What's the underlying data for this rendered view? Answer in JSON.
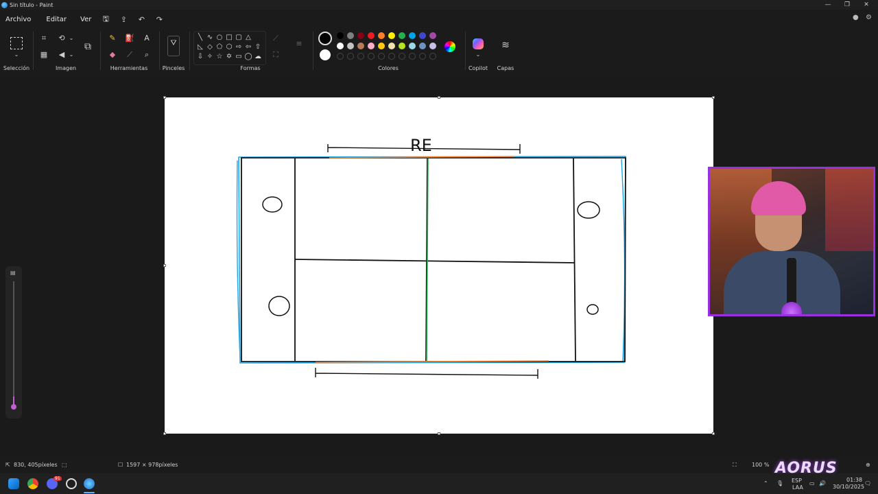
{
  "window": {
    "title": "Sin título - Paint",
    "controls": [
      "—",
      "❐",
      "✕"
    ]
  },
  "menu": {
    "items": [
      "Archivo",
      "Editar",
      "Ver"
    ]
  },
  "ribbon": {
    "groups": {
      "seleccion": "Selección",
      "imagen": "Imagen",
      "herramientas": "Herramientas",
      "pinceles": "Pinceles",
      "formas": "Formas",
      "colores": "Colores",
      "copilot": "Copilot",
      "capas": "Capas"
    },
    "colors": {
      "active_primary": "#000000",
      "active_secondary": "#ffffff",
      "row1": [
        "#000000",
        "#7f7f7f",
        "#880015",
        "#ed1c24",
        "#ff7f27",
        "#fff200",
        "#22b14c",
        "#00a2e8",
        "#3f48cc",
        "#a349a4"
      ],
      "row2": [
        "#ffffff",
        "#c3c3c3",
        "#b97a57",
        "#ffaec9",
        "#ffc90e",
        "#efe4b0",
        "#b5e61d",
        "#99d9ea",
        "#7092be",
        "#c8bfe7"
      ]
    }
  },
  "canvas": {
    "drawing": {
      "label": "RE",
      "stroke_colors": {
        "outline": "#00a2e8",
        "baseline": "#ff7f27",
        "centerline": "#22b14c",
        "lines": "#000000"
      }
    }
  },
  "status": {
    "cursor": "830, 405píxeles",
    "canvas_size": "1597 × 978píxeles",
    "zoom": "100 %"
  },
  "taskbar": {
    "lang": "ESP",
    "lang2": "LAA",
    "time": "01:38",
    "date": "30/10/2025",
    "discord_badge": "91"
  },
  "overlay": {
    "brand": "AORUS"
  }
}
